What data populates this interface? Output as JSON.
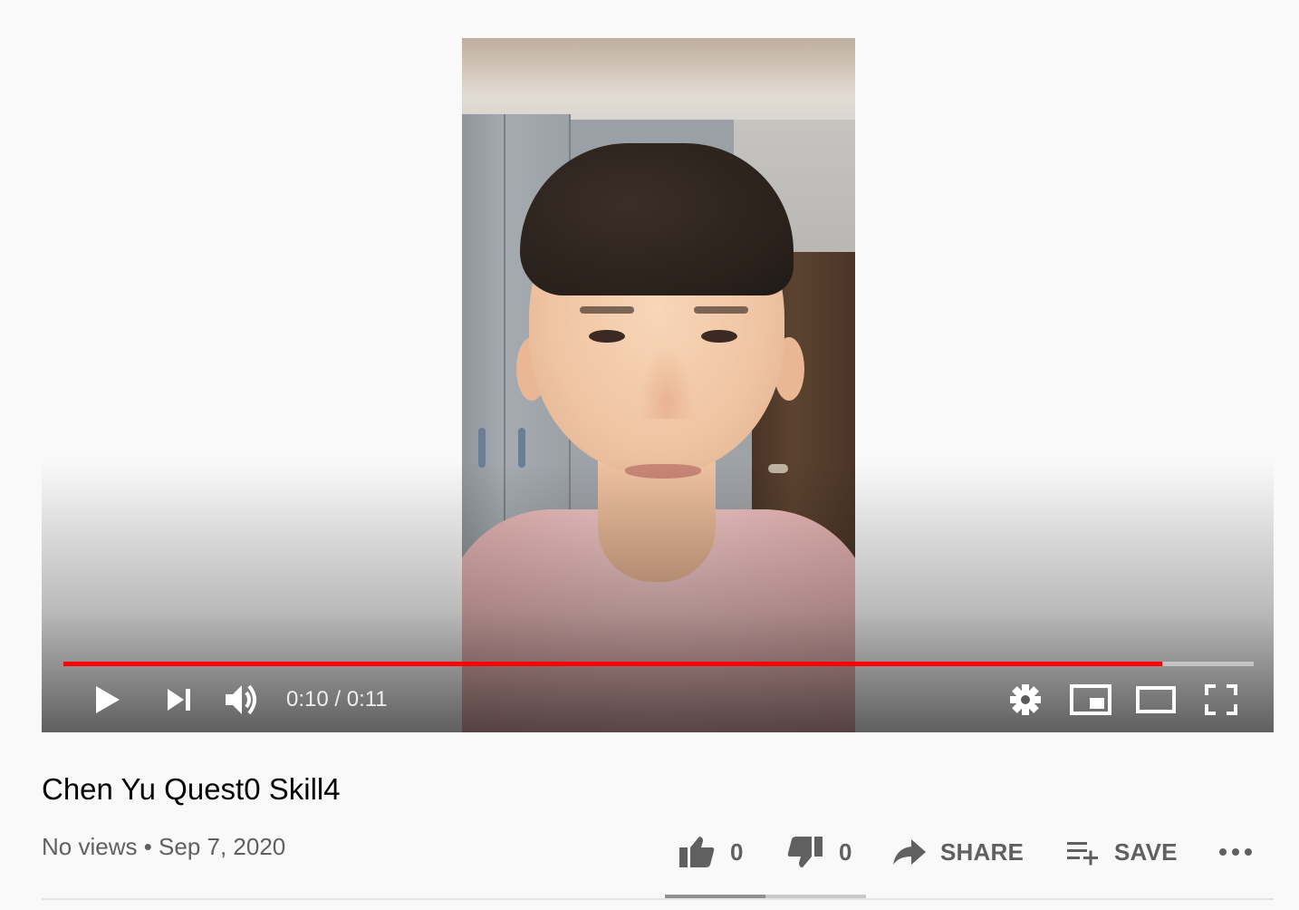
{
  "player": {
    "time_display": "0:10 / 0:11",
    "progress_fraction": 0.923,
    "progress_color": "#ff0000",
    "icons": [
      "play-icon",
      "next-icon",
      "volume-icon",
      "settings-icon",
      "miniplayer-icon",
      "theater-mode-icon",
      "fullscreen-icon"
    ]
  },
  "video": {
    "title": "Chen Yu Quest0 Skill4",
    "meta": "No views • Sep 7, 2020"
  },
  "actions": {
    "like_count": "0",
    "dislike_count": "0",
    "share_label": "SHARE",
    "save_label": "SAVE",
    "like_fraction": 0.5
  }
}
